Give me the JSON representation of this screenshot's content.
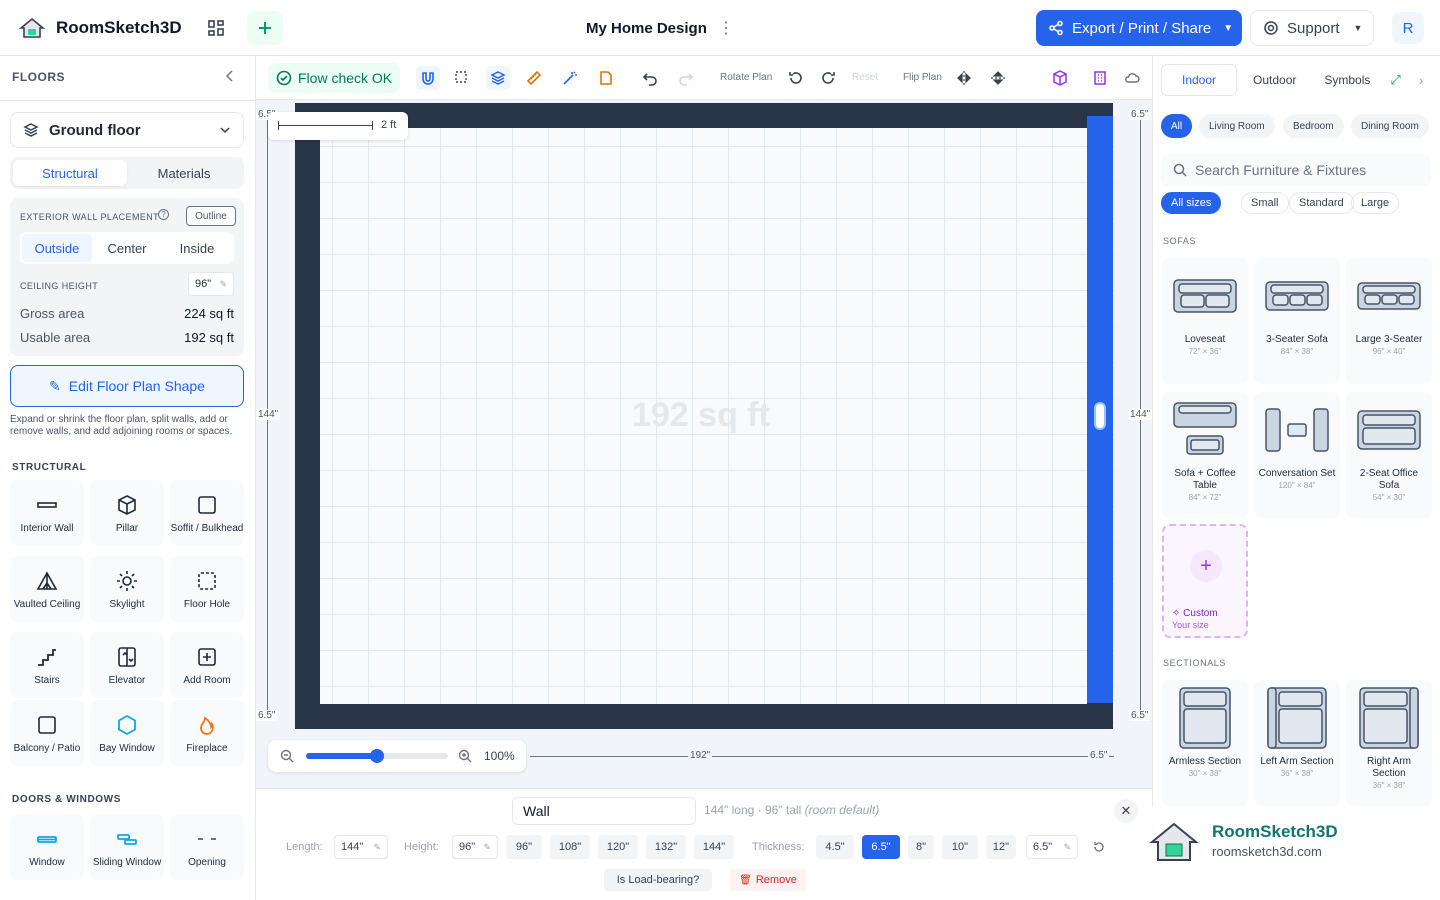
{
  "app": {
    "name": "RoomSketch3D",
    "doc_title": "My Home Design",
    "avatar_initial": "R"
  },
  "header": {
    "export_label": "Export / Print / Share",
    "support_label": "Support"
  },
  "sidebar": {
    "heading": "FLOORS",
    "floor": "Ground floor",
    "tabs": [
      "Structural",
      "Materials"
    ],
    "wall_placement_label": "EXTERIOR WALL PLACEMENT",
    "outline_badge": "Outline",
    "placement": [
      "Outside",
      "Center",
      "Inside"
    ],
    "ceiling_label": "CEILING HEIGHT",
    "ceiling_value": "96\"",
    "gross_label": "Gross area",
    "gross_value": "224 sq ft",
    "usable_label": "Usable area",
    "usable_value": "192 sq ft",
    "edit_label": "Edit Floor Plan Shape",
    "help": "Expand or shrink the floor plan, split walls, add or remove walls, and add adjoining rooms or spaces.",
    "structural_title": "STRUCTURAL",
    "structural": [
      "Interior Wall",
      "Pillar",
      "Soffit / Bulkhead",
      "Vaulted Ceiling",
      "Skylight",
      "Floor Hole",
      "Stairs",
      "Elevator",
      "Add Room",
      "Balcony / Patio",
      "Bay Window",
      "Fireplace"
    ],
    "doors_title": "DOORS & WINDOWS",
    "doors": [
      "Window",
      "Sliding Window",
      "Opening"
    ]
  },
  "toolbar": {
    "flow_label": "Flow check OK",
    "rotate_label": "Rotate Plan",
    "reset_label": "Reset",
    "flip_label": "Flip Plan"
  },
  "canvas": {
    "area_text": "192 sq ft",
    "scale_label": "2 ft",
    "zoom": "100%",
    "dims": {
      "tl": "6.5\"",
      "tr": "6.5\"",
      "bl": "6.5\"",
      "br": "6.5\"",
      "left": "144\"",
      "right": "144\"",
      "bottom": "192\"",
      "bottom_right": "6.5\""
    }
  },
  "props": {
    "name": "Wall",
    "info": "144\" long · 96\" tall",
    "info_note": "(room default)",
    "length_label": "Length:",
    "length_value": "144\"",
    "height_label": "Height:",
    "height_value": "96\"",
    "height_presets": [
      "96\"",
      "108\"",
      "120\"",
      "132\"",
      "144\""
    ],
    "thickness_label": "Thickness:",
    "thickness_presets": [
      "4.5\"",
      "6.5\"",
      "8\"",
      "10\"",
      "12\""
    ],
    "thickness_value": "6.5\"",
    "loadbearing_label": "Is Load-bearing?",
    "remove_label": "Remove"
  },
  "right": {
    "tabs": [
      "Indoor",
      "Outdoor",
      "Symbols"
    ],
    "categories": [
      "All",
      "Living Room",
      "Bedroom",
      "Dining Room"
    ],
    "search_placeholder": "Search Furniture & Fixtures",
    "sizes": [
      "All sizes",
      "Small",
      "Standard",
      "Large"
    ],
    "sofas_title": "SOFAS",
    "sofas": [
      {
        "name": "Loveseat",
        "dims": "72\" × 36\""
      },
      {
        "name": "3-Seater Sofa",
        "dims": "84\" × 38\""
      },
      {
        "name": "Large 3-Seater",
        "dims": "96\" × 40\""
      },
      {
        "name": "Sofa + Coffee Table",
        "dims": "84\" × 72\""
      },
      {
        "name": "Conversation Set",
        "dims": "120\" × 84\""
      },
      {
        "name": "2-Seat Office Sofa",
        "dims": "54\" × 30\""
      }
    ],
    "custom_label": "Custom",
    "custom_sub": "Your size",
    "sectionals_title": "SECTIONALS",
    "sectionals": [
      {
        "name": "Armless Section",
        "dims": "30\" × 38\""
      },
      {
        "name": "Left Arm Section",
        "dims": "36\" × 38\""
      },
      {
        "name": "Right Arm Section",
        "dims": "36\" × 38\""
      }
    ]
  },
  "brand": {
    "name": "RoomSketch3D",
    "url": "roomsketch3d.com"
  },
  "colors": {
    "accent": "#2563eb",
    "wall": "#283447",
    "success": "#047857"
  }
}
